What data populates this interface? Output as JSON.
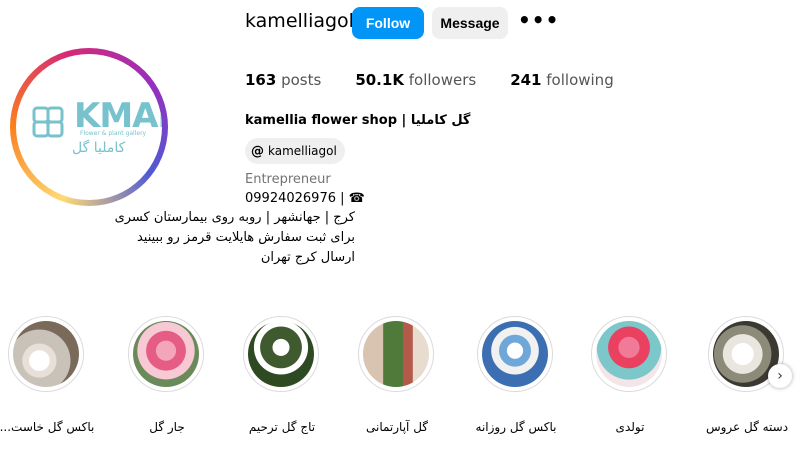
{
  "profile": {
    "username": "kamelliagol",
    "follow_label": "Follow",
    "message_label": "Message",
    "more_icon": "more-horizontal-icon",
    "stats": [
      {
        "count": "163",
        "label": "posts"
      },
      {
        "count": "50.1K",
        "label": "followers"
      },
      {
        "count": "241",
        "label": "following"
      }
    ],
    "full_name": "kamellia flower shop | گل کاملیا",
    "threads_handle": "kamelliagol",
    "category": "Entrepreneur",
    "phone": "09924026976 | ☎",
    "bio": [
      "کرج | جهانشهر | روبه روی بیمارستان کسری",
      "برای ثبت سفارش هایلایت قرمز رو ببینید",
      "ارسال کرج تهران"
    ],
    "avatar": {
      "logo_text": "KMAL",
      "logo_sub": "Flower & plant gallery",
      "logo_fa": "کاملیا گل"
    }
  },
  "highlights": [
    {
      "label": "باکس گل خاست..."
    },
    {
      "label": "جار گل"
    },
    {
      "label": "تاج گل ترحیم"
    },
    {
      "label": "گل آپارتمانی"
    },
    {
      "label": "باکس گل روزانه"
    },
    {
      "label": "تولدی"
    },
    {
      "label": "دسته گل عروس"
    }
  ],
  "colors": {
    "follow_bg": "#0095f6",
    "brand_teal": "#77c2cc",
    "muted": "#737373"
  }
}
